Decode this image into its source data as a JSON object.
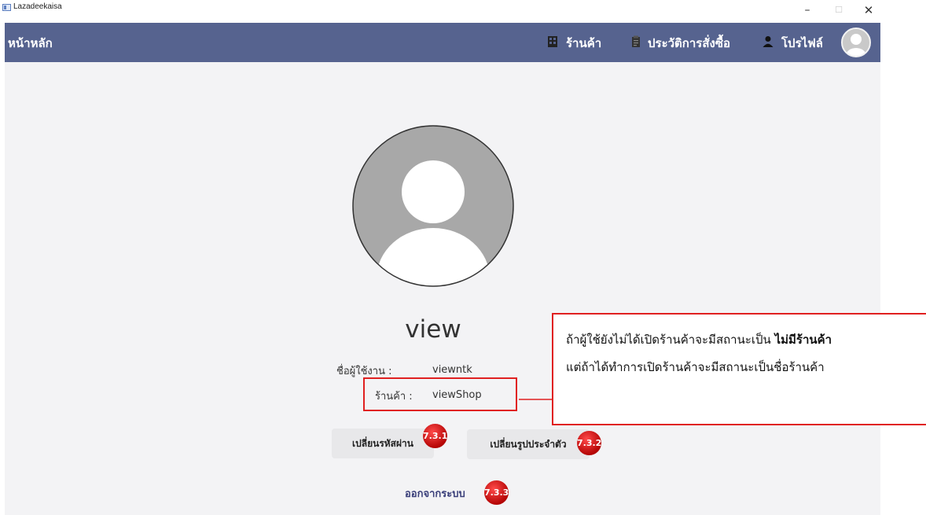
{
  "window": {
    "title": "Lazadeekaisa",
    "minimize_glyph": "–",
    "maximize_glyph": "☐",
    "close_glyph": "✕"
  },
  "navbar": {
    "home": "หน้าหลัก",
    "shop": "ร้านค้า",
    "history": "ประวัติการสั่งซื้อ",
    "profile": "โปรไฟล์",
    "background": "#56638f"
  },
  "profile": {
    "display_name": "view",
    "username_label": "ชื่อผู้ใช้งาน :",
    "username_value": "viewntk",
    "shop_label": "ร้านค้า :",
    "shop_value": "viewShop"
  },
  "actions": {
    "change_password": "เปลี่ยนรหัสผ่าน",
    "change_avatar": "เปลี่ยนรูปประจำตัว",
    "logout": "ออกจากระบบ"
  },
  "badges": {
    "change_password": "7.3.1",
    "change_avatar": "7.3.2",
    "logout": "7.3.3"
  },
  "annotation": {
    "line1_prefix": "ถ้าผู้ใช้ยังไม่ได้เปิดร้านค้าจะมีสถานะเป็น ",
    "line1_bold": "ไม่มีร้านค้า",
    "line2": "แต่ถ้าได้ทำการเปิดร้านค้าจะมีสถานะเป็นชื่อร้านค้า",
    "color": "#e02020"
  },
  "icons": {
    "shop": "store-icon",
    "history": "clipboard-icon",
    "profile": "user-icon",
    "avatar": "default-avatar-icon"
  }
}
